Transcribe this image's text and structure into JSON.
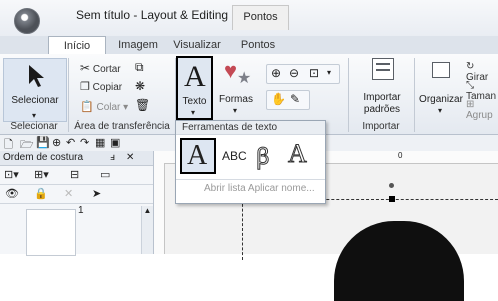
{
  "window": {
    "title": "Sem título - Layout & Editing",
    "context_tab": "Pontos"
  },
  "tabs": [
    {
      "label": "Início",
      "active": true
    },
    {
      "label": "Imagem"
    },
    {
      "label": "Visualizar"
    },
    {
      "label": "Pontos"
    }
  ],
  "ribbon": {
    "selecionar": {
      "button": "Selecionar",
      "group": "Selecionar"
    },
    "clipboard": {
      "cortar": "Cortar",
      "copiar": "Copiar",
      "colar": "Colar",
      "group": "Área de transferência"
    },
    "texto": "Texto",
    "formas": "Formas",
    "importar": {
      "button_line1": "Importar",
      "button_line2": "padrões",
      "group": "Importar"
    },
    "organizar": "Organizar",
    "right_items": [
      "Girar",
      "Taman",
      "Agrup"
    ]
  },
  "left_panel": {
    "title": "Ordem de costura",
    "pin": "ⅎ",
    "close": "✕",
    "item_number": "1"
  },
  "ruler": {
    "label_0": "0"
  },
  "dropdown": {
    "title": "Ferramentas de texto",
    "tools": [
      "A",
      "ABC",
      "ABC-outline",
      "A-outline"
    ],
    "abc_label": "ABC",
    "footer": "Abrir lista Aplicar nome..."
  },
  "colors": {
    "accent": "#000000",
    "ribbon_bg": "#e4e9f0",
    "canvas_bg": "#f2f2f2"
  }
}
